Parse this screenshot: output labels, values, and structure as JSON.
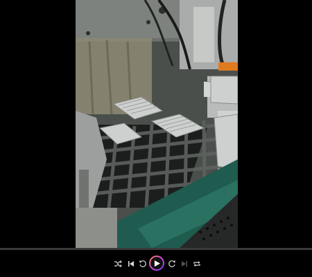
{
  "player": {
    "progress_fraction": 0.0,
    "accent_gradient": [
      "#ff8a3d",
      "#d946ef",
      "#7c3aed"
    ],
    "controls": [
      {
        "name": "shuffle-icon",
        "state": "off"
      },
      {
        "name": "previous-icon",
        "state": "enabled"
      },
      {
        "name": "rewind-10-icon",
        "state": "enabled"
      },
      {
        "name": "play-icon",
        "state": "paused"
      },
      {
        "name": "forward-10-icon",
        "state": "enabled"
      },
      {
        "name": "next-icon",
        "state": "disabled"
      },
      {
        "name": "repeat-icon",
        "state": "off"
      }
    ]
  },
  "colors": {
    "background": "#000000",
    "icon": "#d9d9d9",
    "icon_disabled": "#555555",
    "track": "#3b3b3b"
  }
}
